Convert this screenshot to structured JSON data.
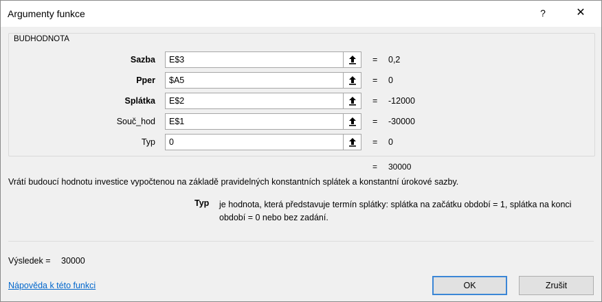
{
  "dialog": {
    "title": "Argumenty funkce",
    "help_glyph": "?",
    "close_glyph": "✕"
  },
  "function_group": {
    "name": "BUDHODNOTA",
    "arguments": [
      {
        "label": "Sazba",
        "bold": true,
        "input": "E$3",
        "equals": "=",
        "value": "0,2"
      },
      {
        "label": "Pper",
        "bold": true,
        "input": "$A5",
        "equals": "=",
        "value": "0"
      },
      {
        "label": "Splátka",
        "bold": true,
        "input": "E$2",
        "equals": "=",
        "value": "-12000"
      },
      {
        "label": "Souč_hod",
        "bold": false,
        "input": "E$1",
        "equals": "=",
        "value": "-30000"
      },
      {
        "label": "Typ",
        "bold": false,
        "input": "0",
        "equals": "=",
        "value": "0"
      }
    ]
  },
  "formula_result": {
    "equals": "=",
    "value": "30000"
  },
  "description": "Vrátí budoucí hodnotu investice vypočtenou na základě pravidelných konstantních splátek a konstantní úrokové sazby.",
  "argument_help": {
    "name": "Typ",
    "text": "je hodnota, která představuje termín splátky: splátka na začátku období = 1, splátka na konci období = 0 nebo bez zadání."
  },
  "result": {
    "label": "Výsledek =",
    "value": "30000"
  },
  "footer": {
    "help_link": "Nápověda k této funkci",
    "ok_label": "OK",
    "cancel_label": "Zrušit"
  },
  "icons": {
    "collapse": "collapse-dialog-icon"
  }
}
